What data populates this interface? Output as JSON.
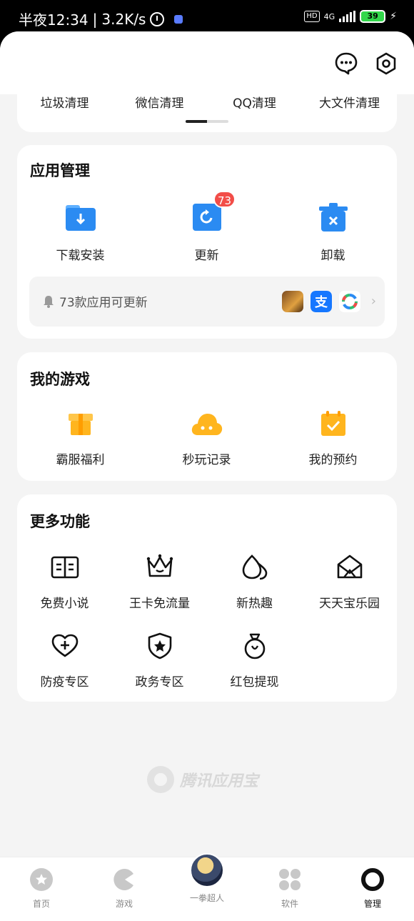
{
  "status_bar": {
    "time": "半夜12:34",
    "speed": "3.2K/s",
    "hd": "HD",
    "network": "4G",
    "battery": "39"
  },
  "clean": {
    "items": [
      "垃圾清理",
      "微信清理",
      "QQ清理",
      "大文件清理"
    ]
  },
  "app_manage": {
    "title": "应用管理",
    "items": [
      {
        "label": "下载安装",
        "icon": "download-folder-icon"
      },
      {
        "label": "更新",
        "icon": "update-icon",
        "badge": "73"
      },
      {
        "label": "卸载",
        "icon": "uninstall-icon"
      }
    ],
    "update_notice": "73款应用可更新"
  },
  "my_games": {
    "title": "我的游戏",
    "items": [
      {
        "label": "霸服福利",
        "icon": "gift-icon"
      },
      {
        "label": "秒玩记录",
        "icon": "cloud-game-icon"
      },
      {
        "label": "我的预约",
        "icon": "calendar-check-icon"
      }
    ]
  },
  "more": {
    "title": "更多功能",
    "row1": [
      {
        "label": "免费小说",
        "icon": "book-icon"
      },
      {
        "label": "王卡免流量",
        "icon": "crown-icon"
      },
      {
        "label": "新热趣",
        "icon": "drop-icon"
      },
      {
        "label": "天天宝乐园",
        "icon": "tent-icon"
      }
    ],
    "row2": [
      {
        "label": "防疫专区",
        "icon": "heart-plus-icon"
      },
      {
        "label": "政务专区",
        "icon": "shield-star-icon"
      },
      {
        "label": "红包提现",
        "icon": "money-bag-icon"
      }
    ]
  },
  "watermark": "腾讯应用宝",
  "bottom_nav": [
    "首页",
    "游戏",
    "一拳超人",
    "软件",
    "管理"
  ],
  "colors": {
    "accent": "#2b8bf2",
    "game_yellow": "#ffb51e",
    "badge": "#f24d48"
  }
}
